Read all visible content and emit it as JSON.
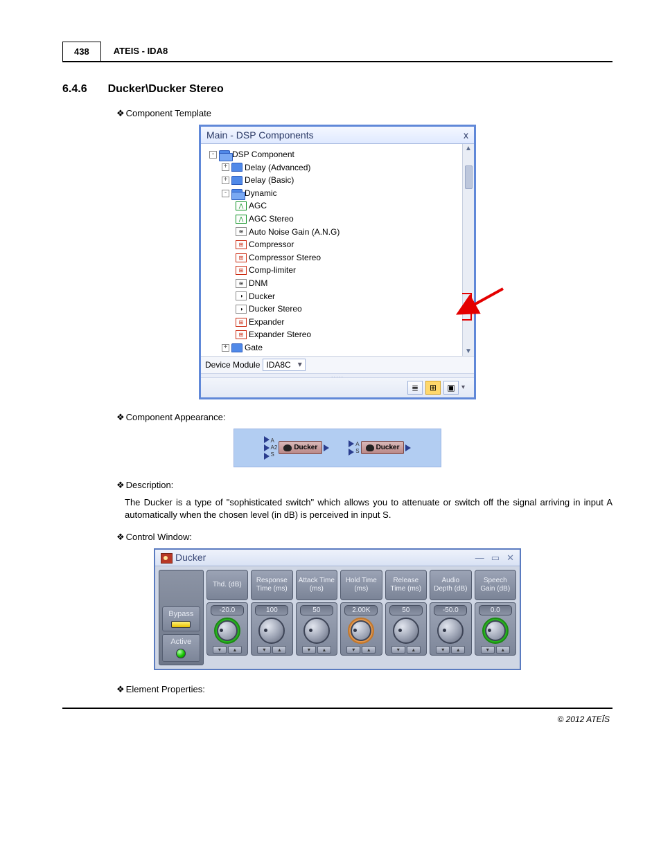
{
  "header": {
    "page_number": "438",
    "title": "ATEIS - IDA8"
  },
  "section": {
    "number": "6.4.6",
    "title": "Ducker\\Ducker Stereo"
  },
  "bullets": {
    "template": "Component Template",
    "appearance": "Component Appearance:",
    "description": "Description:",
    "control_window": "Control Window:",
    "element_properties": "Element Properties:"
  },
  "tree": {
    "title": "Main - DSP Components",
    "close": "x",
    "nodes": {
      "root": "DSP Component",
      "delay_adv": "Delay (Advanced)",
      "delay_basic": "Delay (Basic)",
      "dynamic": "Dynamic",
      "agc": "AGC",
      "agc_stereo": "AGC Stereo",
      "ang": "Auto Noise Gain (A.N.G)",
      "compressor": "Compressor",
      "compressor_stereo": "Compressor Stereo",
      "comp_limiter": "Comp-limiter",
      "dnm": "DNM",
      "ducker": "Ducker",
      "ducker_stereo": "Ducker Stereo",
      "expander": "Expander",
      "expander_stereo": "Expander Stereo",
      "gate": "Gate"
    },
    "footer": {
      "label": "Device Module",
      "value": "IDA8C"
    }
  },
  "appearance": {
    "block1": {
      "ports": [
        "A",
        "A2",
        "S"
      ],
      "label": "Ducker"
    },
    "block2": {
      "ports": [
        "A",
        "S"
      ],
      "label": "Ducker"
    }
  },
  "description_text": "The Ducker is a type of \"sophisticated switch\" which allows you to attenuate or switch off the signal arriving in input A automatically when the chosen level (in dB) is perceived in input S.",
  "control": {
    "title": "Ducker",
    "side": {
      "bypass": "Bypass",
      "active": "Active"
    },
    "params": [
      {
        "head": "Thd.\n(dB)",
        "value": "-20.0"
      },
      {
        "head": "Response\nTime\n(ms)",
        "value": "100"
      },
      {
        "head": "Attack\nTime\n(ms)",
        "value": "50"
      },
      {
        "head": "Hold\nTime\n(ms)",
        "value": "2.00K"
      },
      {
        "head": "Release\nTime\n(ms)",
        "value": "50"
      },
      {
        "head": "Audio\nDepth\n(dB)",
        "value": "-50.0"
      },
      {
        "head": "Speech\nGain\n(dB)",
        "value": "0.0"
      }
    ]
  },
  "copyright": "© 2012 ATEÏS"
}
